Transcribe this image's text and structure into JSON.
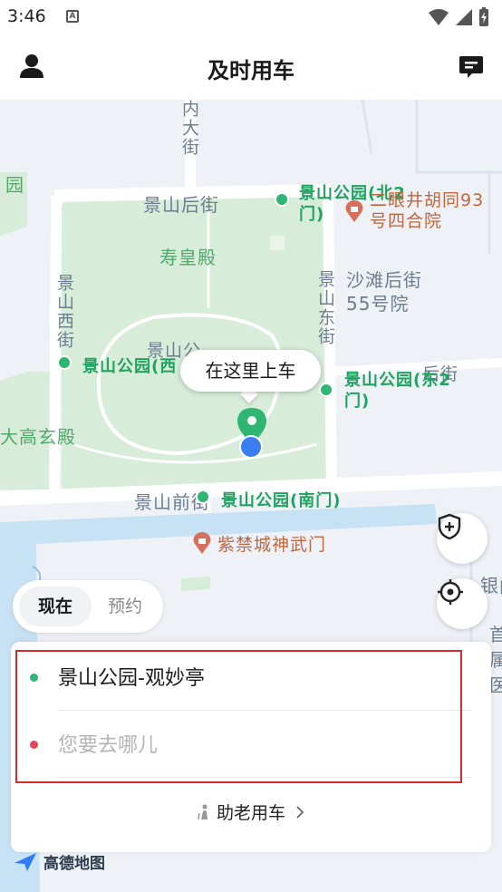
{
  "status": {
    "time": "3:46"
  },
  "header": {
    "title": "及时用车",
    "user_icon": "person-icon",
    "message_icon": "message-icon"
  },
  "map": {
    "roads": {
      "neida": "内大街",
      "houjie": "景山后街",
      "xijie": "景山西街",
      "dongjie": "景山东街",
      "qianjie": "景山前街",
      "shatan_partial": "后街",
      "jingshan_partial": "景山公",
      "dongqi_partial": "东"
    },
    "places": {
      "shouhuang": "寿皇殿",
      "shatan": "沙滩后街55号院",
      "dagaoxuan": "大高玄殿",
      "left_edge": "园"
    },
    "pois": {
      "north_gate": "景山公园(北2门)",
      "west_gate": "景山公园(西",
      "east_gate": "景山公园(东2门)",
      "south_gate": "景山公园(南门)",
      "siheyuan": "二眼井胡同93号四合院",
      "shenwu": "紫禁城神武门"
    },
    "bubble_label": "在这里上车",
    "right_edge_fragments": [
      "银闸",
      "首都",
      "属",
      "医"
    ],
    "logo": "高德地图"
  },
  "mode": {
    "now": "现在",
    "book": "预约"
  },
  "trip": {
    "origin": "景山公园-观妙亭",
    "destination_placeholder": "您要去哪儿",
    "elder_label": "助老用车"
  },
  "colors": {
    "origin_dot": "#2fb673",
    "destination_dot": "#e0475a",
    "park": "#d7ecd9",
    "water": "#c7e2f5",
    "highlight": "#d42b2b"
  }
}
